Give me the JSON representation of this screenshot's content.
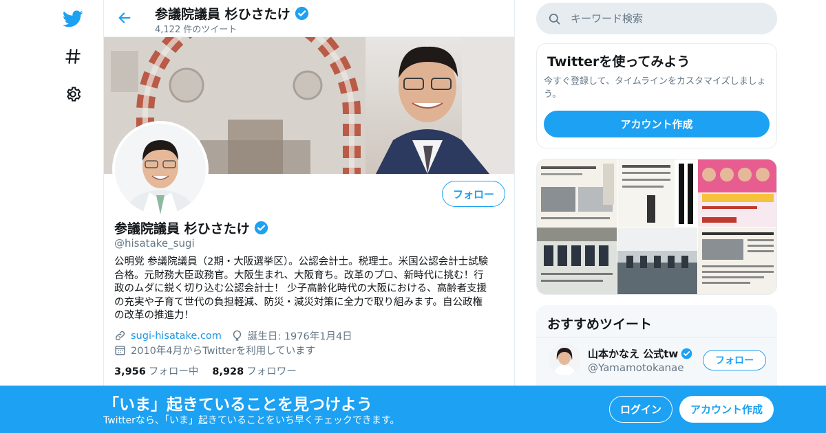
{
  "nav": {
    "logo_icon": "twitter-bird-icon",
    "explore_icon": "hashtag-icon",
    "settings_icon": "gear-icon"
  },
  "header": {
    "name": "参議院議員 杉ひさたけ",
    "tweet_count": "4,122 件のツイート"
  },
  "profile": {
    "name": "参議院議員 杉ひさたけ",
    "handle": "@hisatake_sugi",
    "follow_label": "フォロー",
    "bio_lines": [
      "公明党 参議院議員（2期・大阪選挙区）。公認会計士。税理士。米国公認会計士試験",
      "合格。元財務大臣政務官。大阪生まれ、大阪育ち。改革のプロ、新時代に挑む！行",
      "政のムダに鋭く切り込む公認会計士！ 少子高齢化時代の大阪における、高齢者支援",
      "の充実や子育て世代の負担軽減、防災・減災対策に全力で取り組みます。自公政権",
      "の改革の推進力！"
    ],
    "url": "sugi-hisatake.com",
    "birthday": "誕生日: 1976年1月4日",
    "joined": "2010年4月からTwitterを利用しています",
    "following_count": "3,956",
    "following_label": "フォロー中",
    "followers_count": "8,928",
    "followers_label": "フォロワー"
  },
  "sidebar": {
    "search_placeholder": "キーワード検索",
    "signup_card": {
      "title": "Twitterを使ってみよう",
      "desc": "今すぐ登録して、タイムラインをカスタマイズしましょう。",
      "button": "アカウント作成"
    },
    "recommended": {
      "title": "おすすめツイート",
      "name": "山本かなえ 公式tw",
      "handle": "@Yamamotokanae",
      "follow_label": "フォロー"
    }
  },
  "bottom_bar": {
    "title": "「いま」起きていることを見つけよう",
    "subtitle": "Twitterなら、「いま」起きていることをいち早くチェックできます。",
    "login": "ログイン",
    "signup": "アカウント作成"
  },
  "colors": {
    "accent": "#1da1f2",
    "text_secondary": "#657786",
    "border": "#e6ecf0"
  }
}
